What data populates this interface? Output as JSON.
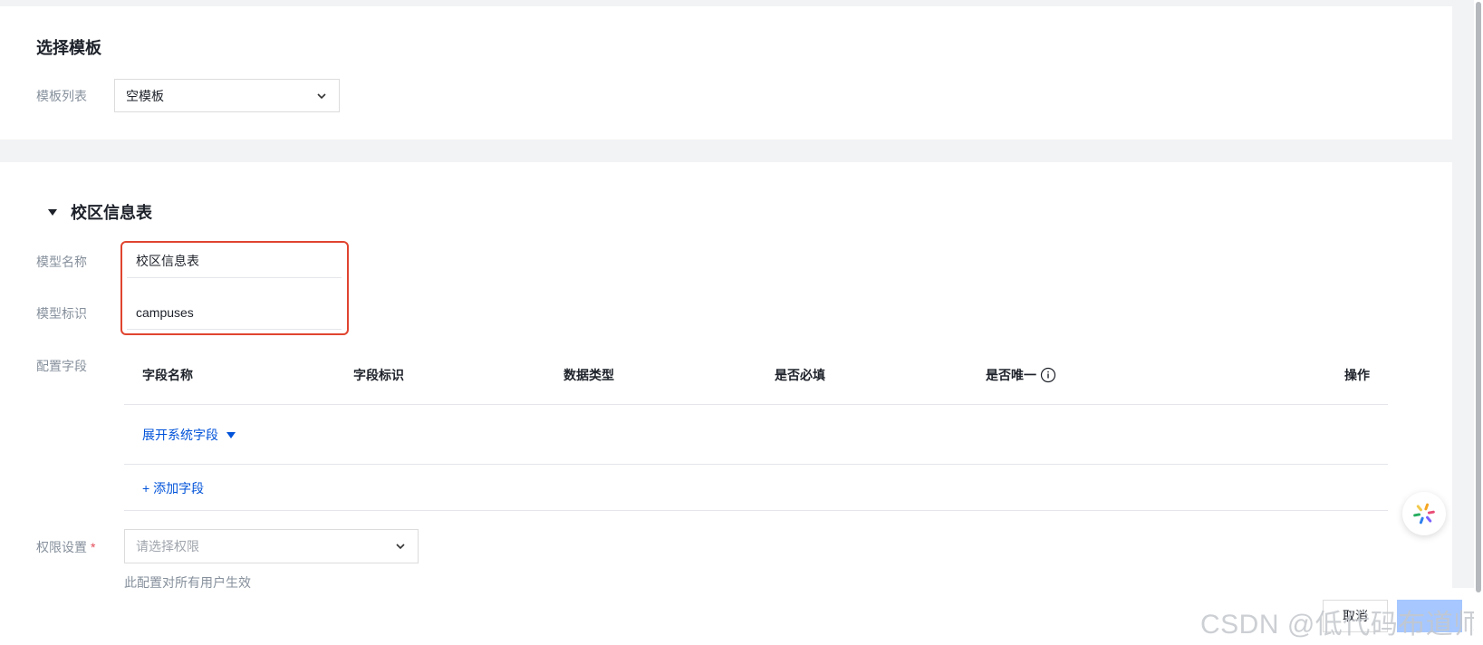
{
  "template_section": {
    "title": "选择模板",
    "template_list_label": "模板列表",
    "template_selected": "空模板"
  },
  "model_section": {
    "title": "校区信息表",
    "name_label": "模型名称",
    "name_value": "校区信息表",
    "id_label": "模型标识",
    "id_value": "campuses",
    "fields_label": "配置字段",
    "table_headers": [
      "字段名称",
      "字段标识",
      "数据类型",
      "是否必填",
      "是否唯一",
      "操作"
    ],
    "expand_system_fields": "展开系统字段",
    "add_field": "+ 添加字段",
    "permission_label": "权限设置",
    "permission_required_mark": "*",
    "permission_placeholder": "请选择权限",
    "permission_hint": "此配置对所有用户生效"
  },
  "footer": {
    "cancel_label": "取消",
    "watermark": "CSDN @低代码布道师"
  },
  "colors": {
    "accent": "#0052d9",
    "highlight_border": "#e0442f",
    "required": "#e34d59"
  }
}
